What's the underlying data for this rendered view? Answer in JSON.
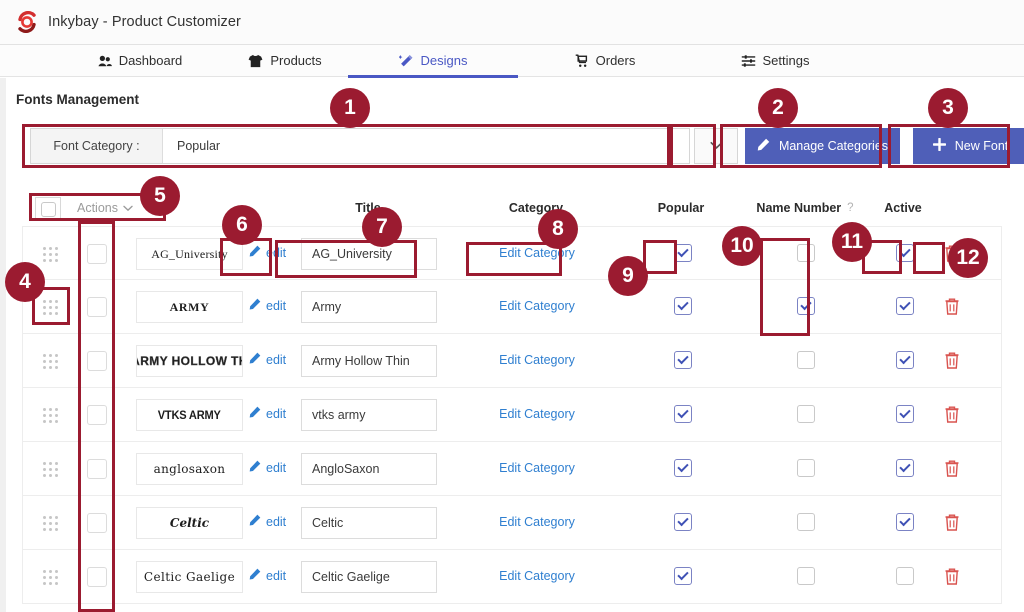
{
  "window": {
    "title": "Inkybay - Product Customizer",
    "logo_icon": "inkybay-swirl-logo"
  },
  "tabs": [
    {
      "label": "Dashboard",
      "icon": "dashboard-icon",
      "active": false
    },
    {
      "label": "Products",
      "icon": "tshirt-icon",
      "active": false
    },
    {
      "label": "Designs",
      "icon": "magic-wand-icon",
      "active": true
    },
    {
      "label": "Orders",
      "icon": "cart-icon",
      "active": false
    },
    {
      "label": "Settings",
      "icon": "sliders-icon",
      "active": false
    }
  ],
  "page": {
    "section_title": "Fonts Management"
  },
  "filter": {
    "category_label": "Font Category :",
    "category_value": "Popular",
    "caret_icon": "chevron-down-icon",
    "manage_categories_label": "Manage Categories",
    "manage_categories_icon": "pencil-icon",
    "new_font_label": "New Font",
    "new_font_icon": "plus-icon",
    "button_color": "#4f5fb8"
  },
  "table": {
    "actions_label": "Actions",
    "actions_caret_icon": "chevron-down-icon",
    "columns": [
      "Title",
      "Category",
      "Popular",
      "Name Number",
      "Active"
    ],
    "name_number_help": "?",
    "edit_label": "edit",
    "edit_category_label": "Edit Category",
    "drag_handle_icon": "drag-handle-icon",
    "delete_icon": "trash-icon",
    "rows": [
      {
        "preview": "AG_University",
        "title": "AG_University",
        "category": "Edit Category",
        "popular": true,
        "name_number": false,
        "active": true
      },
      {
        "preview": "ARMY",
        "title": "Army",
        "category": "Edit Category",
        "popular": true,
        "name_number": true,
        "active": true
      },
      {
        "preview": "ARMY HOLLOW TH",
        "title": "Army Hollow Thin",
        "category": "Edit Category",
        "popular": true,
        "name_number": false,
        "active": true
      },
      {
        "preview": "VTKS ARMY",
        "title": "vtks army",
        "category": "Edit Category",
        "popular": true,
        "name_number": false,
        "active": true
      },
      {
        "preview": "anglosaxon",
        "title": "AngloSaxon",
        "category": "Edit Category",
        "popular": true,
        "name_number": false,
        "active": true
      },
      {
        "preview": "Celtic",
        "title": "Celtic",
        "category": "Edit Category",
        "popular": true,
        "name_number": false,
        "active": true
      },
      {
        "preview": "Celtic Gaelige",
        "title": "Celtic Gaelige",
        "category": "Edit Category",
        "popular": true,
        "name_number": false,
        "active": false
      }
    ]
  },
  "annotations": {
    "color": "#9b1b30",
    "badges": [
      "1",
      "2",
      "3",
      "4",
      "5",
      "6",
      "7",
      "8",
      "9",
      "10",
      "11",
      "12"
    ]
  }
}
